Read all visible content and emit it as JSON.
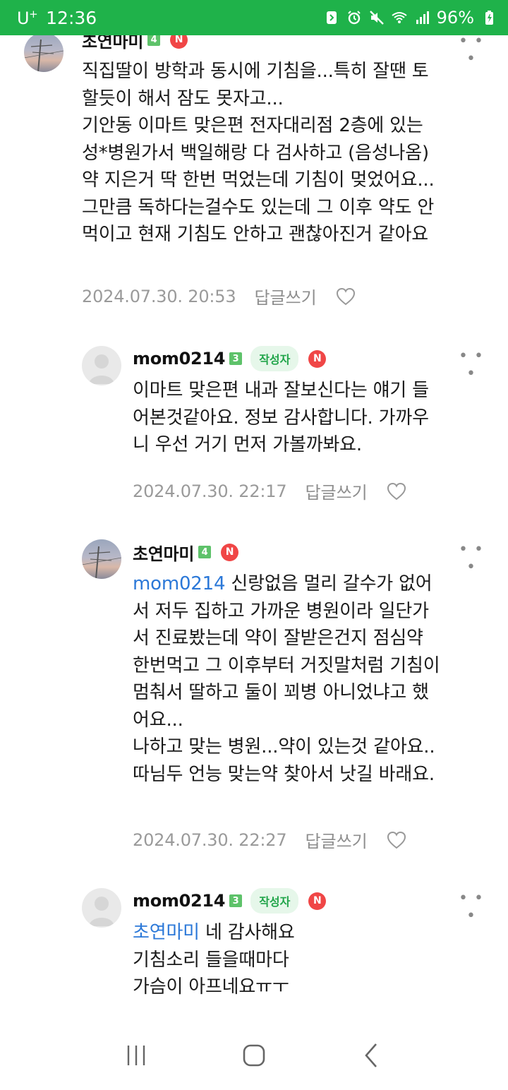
{
  "status_bar": {
    "carrier": "U",
    "carrier_sup": "+",
    "time": "12:36",
    "battery": "96%",
    "icons": [
      "nfc-icon",
      "alarm-icon",
      "mute-icon",
      "wifi-icon",
      "signal-icon",
      "battery-charging-icon"
    ]
  },
  "comments": [
    {
      "nick": "초연마미",
      "level": "4",
      "is_writer": false,
      "body": "직집딸이 방학과 동시에 기침을...특히 잘땐 토\n할듯이 해서 잠도 못자고...\n기안동 이마트 맞은편 전자대리점 2층에 있는\n성*병원가서 백일해랑 다 검사하고 (음성나옴)\n약 지은거 딱 한번 먹었는데 기침이 멎었어요...\n그만큼 독하다는걸수도 있는데 그 이후 약도 안\n먹이고 현재 기침도 안하고 괜찮아진거 같아요",
      "date": "2024.07.30. 20:53",
      "reply_label": "답글쓰기"
    },
    {
      "nick": "mom0214",
      "level": "3",
      "is_writer": true,
      "writer_label": "작성자",
      "body": "이마트 맞은편 내과 잘보신다는 얘기 들\n어본것같아요. 정보 감사합니다. 가까우\n니 우선 거기 먼저 가볼까봐요.",
      "date": "2024.07.30. 22:17",
      "reply_label": "답글쓰기"
    },
    {
      "nick": "초연마미",
      "level": "4",
      "is_writer": false,
      "mention": "mom0214",
      "body": " 신랑없음 멀리 갈수가 없어\n서 저두 집하고 가까운 병원이라 일단가\n서 진료봤는데 약이 잘받은건지 점심약\n한번먹고 그 이후부터 거짓말처럼 기침이\n멈춰서 딸하고 둘이 꾀병 아니었냐고 했\n어요...\n나하고 맞는 병원...약이 있는것 같아요..\n따님두 언능 맞는약 찾아서 낫길 바래요.",
      "date": "2024.07.30. 22:27",
      "reply_label": "답글쓰기"
    },
    {
      "nick": "mom0214",
      "level": "3",
      "is_writer": true,
      "writer_label": "작성자",
      "mention": "초연마미",
      "body": " 네 감사해요\n기침소리 들을때마다\n가슴이 아프네요ㅠㅜ",
      "reply_label": "답글쓰기"
    }
  ],
  "badges": {
    "new": "N"
  },
  "more_label": "• • •",
  "nav": {
    "recent_icon": "recent-apps-icon",
    "home_icon": "home-icon",
    "back_icon": "back-icon"
  }
}
